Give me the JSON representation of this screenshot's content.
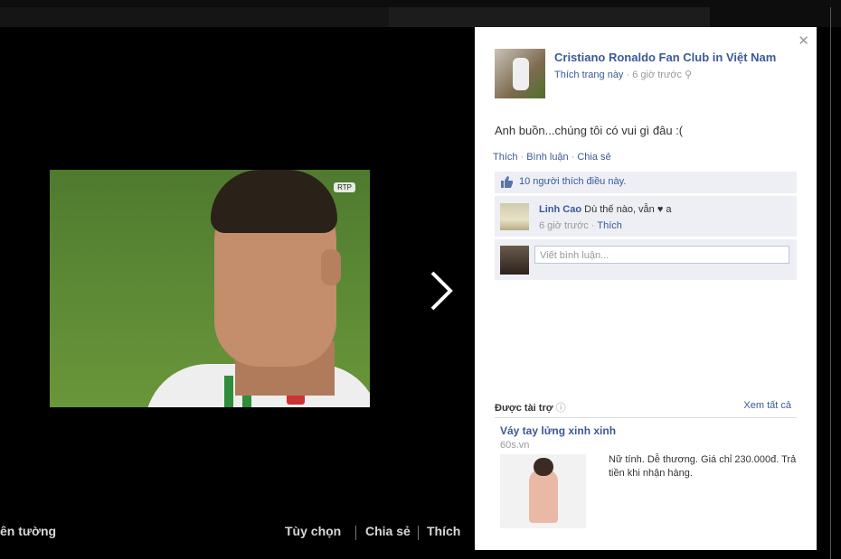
{
  "viewer": {
    "tv_logo": "RTP",
    "bottom_left": "ên tường",
    "options": "Tùy chọn",
    "share": "Chia sẻ",
    "like": "Thích"
  },
  "post": {
    "page_name": "Cristiano Ronaldo Fan Club in Việt Nam",
    "like_page": "Thích trang này",
    "time": "6 giờ trước",
    "text": "Anh buồn...chúng tôi có vui gì đâu :(",
    "actions": [
      "Thích",
      "Bình luận",
      "Chia sẻ"
    ],
    "likes": "10 người thích điều này."
  },
  "comment": {
    "name": "Linh Cao",
    "text": "Dù thế nào, vẫn ♥ a",
    "time": "6 giờ trước",
    "like": "Thích"
  },
  "composer": {
    "placeholder": "Viết bình luận..."
  },
  "sponsored": {
    "header": "Được tài trợ",
    "see_all": "Xem tất cả",
    "ad": {
      "title": "Váy tay lửng xinh xinh",
      "domain": "60s.vn",
      "text": "Nữ tính. Dễ thương. Giá chỉ 230.000đ. Trả tiền khi nhận hàng."
    }
  },
  "colors": {
    "link": "#3b5998",
    "panel_bg": "#ffffff",
    "viewer_bg": "#000000",
    "comment_bg": "#edeff4"
  }
}
